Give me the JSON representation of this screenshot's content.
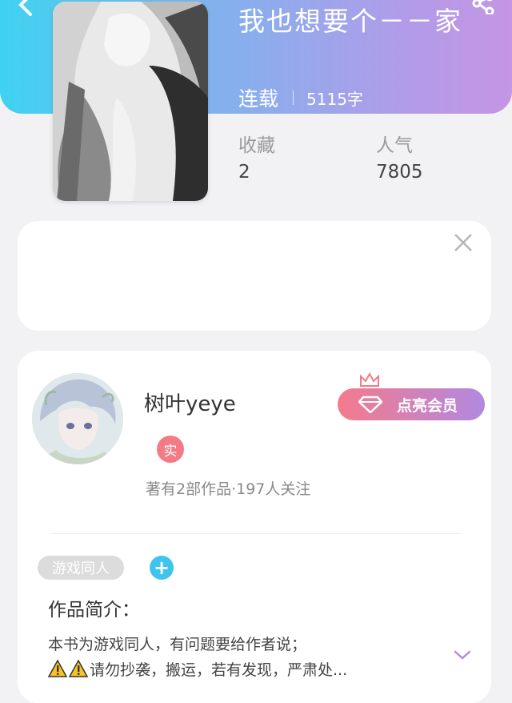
{
  "book": {
    "title": "我也想要个－－家",
    "status": "连载",
    "word_count": "5115字"
  },
  "stats": {
    "favorites_label": "收藏",
    "favorites_value": "2",
    "popularity_label": "人气",
    "popularity_value": "7805"
  },
  "author": {
    "name": "树叶yeye",
    "verified_label": "实",
    "stats_text": "著有2部作品·197人关注",
    "vip_button_label": "点亮会员"
  },
  "tags": [
    "游戏同人"
  ],
  "add_tag_label": "+",
  "intro": {
    "title": "作品简介：",
    "line1": "本书为游戏同人，有问题要给作者说；",
    "line2": "请勿抄袭，搬运，若有发现，严肃处..."
  },
  "colors": {
    "header_gradient_start": "#3fd2f0",
    "header_gradient_end": "#c496e4",
    "vip_gradient_start": "#f57a8c",
    "vip_gradient_end": "#b188e0",
    "add_tag": "#3fc4ee",
    "verified_badge": "#f47a85",
    "expand_arrow": "#b38be0"
  },
  "icons": {
    "back": "chevron-left-icon",
    "share": "share-icon",
    "close": "close-icon",
    "crown": "crown-icon",
    "diamond": "diamond-icon",
    "warning": "warning-icon",
    "expand": "chevron-down-icon"
  }
}
